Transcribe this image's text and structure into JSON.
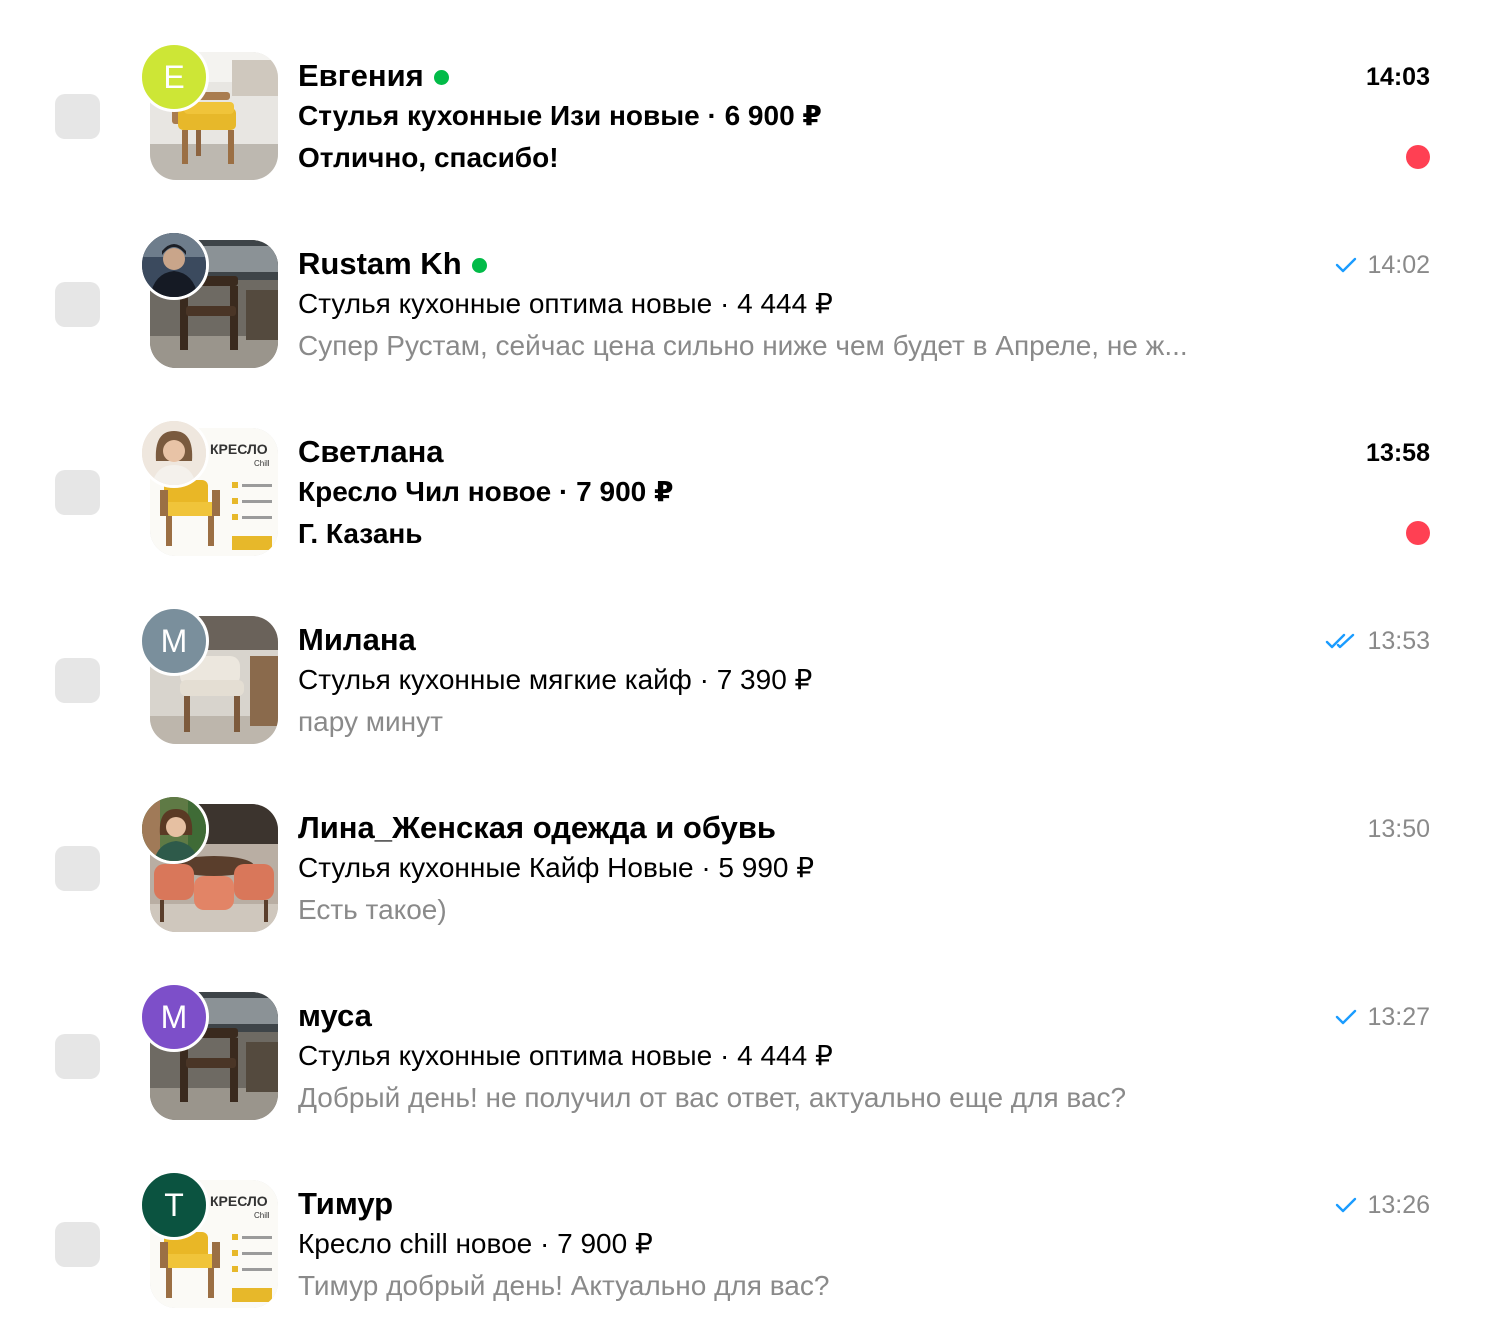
{
  "colors": {
    "online": "#02bb48",
    "unread_badge": "#ff4053",
    "read_check": "#1a9cff",
    "secondary_text": "#8a8a8a",
    "checkbox": "#e6e6e6"
  },
  "chats": [
    {
      "name": "Евгения",
      "online": true,
      "ad": "Стулья кухонные Изи новые · 6 900 ₽",
      "message": "Отлично, спасибо!",
      "time": "14:03",
      "unread": true,
      "status_icon": "none",
      "avatar": {
        "type": "letter",
        "letter": "Е",
        "color": "#cde636"
      },
      "thumbnail": "yellow-armchair-photo"
    },
    {
      "name": "Rustam Kh",
      "online": true,
      "ad": "Стулья кухонные оптима новые · 4 444 ₽",
      "message": "Супер Рустам, сейчас цена сильно ниже чем будет в Апреле, не ж...",
      "time": "14:02",
      "unread": false,
      "status_icon": "single-check-icon",
      "avatar": {
        "type": "photo",
        "subject": "man-in-dark-jacket-photo"
      },
      "thumbnail": "dark-wooden-chair-photo"
    },
    {
      "name": "Светлана",
      "online": false,
      "ad": "Кресло Чил новое · 7 900 ₽",
      "message": "Г. Казань",
      "time": "13:58",
      "unread": true,
      "status_icon": "none",
      "avatar": {
        "type": "photo",
        "subject": "woman-portrait-photo"
      },
      "thumbnail": "armchair-promo-card"
    },
    {
      "name": "Милана",
      "online": false,
      "ad": "Стулья кухонные мягкие кайф · 7 390 ₽",
      "message": "пару минут",
      "time": "13:53",
      "unread": false,
      "status_icon": "double-check-icon",
      "avatar": {
        "type": "letter",
        "letter": "М",
        "color": "#7a8f9c"
      },
      "thumbnail": "beige-upholstered-chair-photo"
    },
    {
      "name": "Лина_Женская одежда и обувь",
      "online": false,
      "ad": "Стулья кухонные Кайф Новые · 5 990 ₽",
      "message": "Есть такое)",
      "time": "13:50",
      "unread": false,
      "status_icon": "none",
      "avatar": {
        "type": "photo",
        "subject": "woman-with-plants-photo"
      },
      "thumbnail": "terracotta-dining-set-photo"
    },
    {
      "name": "муса",
      "online": false,
      "ad": "Стулья кухонные оптима новые · 4 444 ₽",
      "message": "Добрый день! не получил от вас ответ, актуально еще для вас?",
      "time": "13:27",
      "unread": false,
      "status_icon": "single-check-icon",
      "avatar": {
        "type": "letter",
        "letter": "М",
        "color": "#7d4fc9"
      },
      "thumbnail": "dark-wooden-chair-photo"
    },
    {
      "name": "Тимур",
      "online": false,
      "ad": "Кресло chill новое · 7 900 ₽",
      "message": "Тимур добрый день! Актуально для вас?",
      "time": "13:26",
      "unread": false,
      "status_icon": "single-check-icon",
      "avatar": {
        "type": "letter",
        "letter": "Т",
        "color": "#0b5340"
      },
      "thumbnail": "armchair-promo-card"
    }
  ]
}
